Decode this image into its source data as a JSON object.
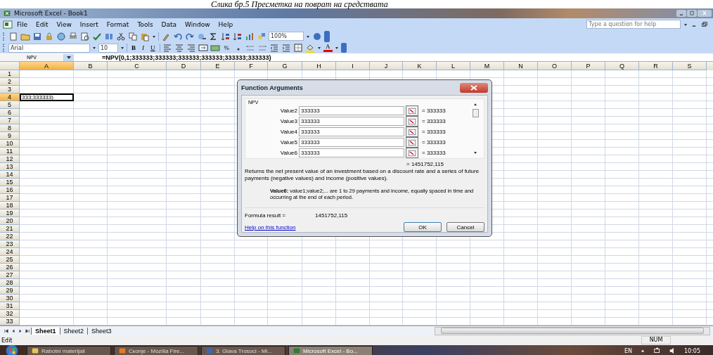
{
  "caption": "Слика бр.5 Пресметка на поврат на средствата",
  "window": {
    "title": "Microsoft Excel - Book1"
  },
  "menu": [
    "File",
    "Edit",
    "View",
    "Insert",
    "Format",
    "Tools",
    "Data",
    "Window",
    "Help"
  ],
  "help_box": {
    "placeholder": "Type a question for help"
  },
  "toolbar": {
    "zoom": "100%"
  },
  "formatting": {
    "font": "Arial",
    "size": "10",
    "buttons": [
      "B",
      "I",
      "U"
    ],
    "percent": "%",
    "font_color": "A"
  },
  "formula_bar": {
    "name_box": "NPV",
    "formula": "=NPV(0,1;333333;333333;333333;333333;333333;333333)"
  },
  "columns": [
    {
      "label": "A",
      "selected": true
    },
    {
      "label": "B",
      "selected": false
    },
    {
      "label": "C",
      "selected": false
    },
    {
      "label": "D",
      "selected": false
    },
    {
      "label": "E",
      "selected": false
    },
    {
      "label": "F",
      "selected": false
    },
    {
      "label": "G",
      "selected": false
    },
    {
      "label": "H",
      "selected": false
    },
    {
      "label": "I",
      "selected": false
    },
    {
      "label": "J",
      "selected": false
    },
    {
      "label": "K",
      "selected": false
    },
    {
      "label": "L",
      "selected": false
    },
    {
      "label": "M",
      "selected": false
    },
    {
      "label": "N",
      "selected": false
    },
    {
      "label": "O",
      "selected": false
    },
    {
      "label": "P",
      "selected": false
    },
    {
      "label": "Q",
      "selected": false
    },
    {
      "label": "R",
      "selected": false
    },
    {
      "label": "S",
      "selected": false
    }
  ],
  "rows": [
    {
      "label": "1",
      "selected": false
    },
    {
      "label": "2",
      "selected": false
    },
    {
      "label": "3",
      "selected": false
    },
    {
      "label": "4",
      "selected": true,
      "column_a": "333;333333)"
    },
    {
      "label": "5",
      "selected": false
    },
    {
      "label": "6",
      "selected": false
    },
    {
      "label": "7",
      "selected": false
    },
    {
      "label": "8",
      "selected": false
    },
    {
      "label": "9",
      "selected": false
    },
    {
      "label": "10",
      "selected": false
    },
    {
      "label": "11",
      "selected": false
    },
    {
      "label": "12",
      "selected": false
    },
    {
      "label": "13",
      "selected": false
    },
    {
      "label": "14",
      "selected": false
    },
    {
      "label": "15",
      "selected": false
    },
    {
      "label": "16",
      "selected": false
    },
    {
      "label": "17",
      "selected": false
    },
    {
      "label": "18",
      "selected": false
    },
    {
      "label": "19",
      "selected": false
    },
    {
      "label": "20",
      "selected": false
    },
    {
      "label": "21",
      "selected": false
    },
    {
      "label": "22",
      "selected": false
    },
    {
      "label": "23",
      "selected": false
    },
    {
      "label": "24",
      "selected": false
    },
    {
      "label": "25",
      "selected": false
    },
    {
      "label": "26",
      "selected": false
    },
    {
      "label": "27",
      "selected": false
    },
    {
      "label": "28",
      "selected": false
    },
    {
      "label": "29",
      "selected": false
    },
    {
      "label": "30",
      "selected": false
    },
    {
      "label": "31",
      "selected": false
    },
    {
      "label": "32",
      "selected": false
    },
    {
      "label": "33",
      "selected": false
    }
  ],
  "dialog": {
    "title": "Function Arguments",
    "function": "NPV",
    "arguments": [
      {
        "label": "Value2",
        "value": "333333",
        "result": "= 333333"
      },
      {
        "label": "Value3",
        "value": "333333",
        "result": "= 333333"
      },
      {
        "label": "Value4",
        "value": "333333",
        "result": "= 333333"
      },
      {
        "label": "Value5",
        "value": "333333",
        "result": "= 333333"
      },
      {
        "label": "Value6",
        "value": "333333",
        "result": "= 333333"
      }
    ],
    "total": "= 1451752,115",
    "description": "Returns the net present value of an investment based on a discount rate and a series of future payments (negative values) and income (positive values).",
    "argument_name": "Value6:",
    "argument_help": "value1;value2;... are 1 to 29 payments and income, equally spaced in time and occurring at the end of each period.",
    "formula_result_label": "Formula result =",
    "formula_result": "1451752,115",
    "help_link": "Help on this function",
    "buttons": [
      "OK",
      "Cancel"
    ]
  },
  "sheet_tabs": [
    {
      "label": "Sheet1",
      "selected": true
    },
    {
      "label": "Sheet2",
      "selected": false
    },
    {
      "label": "Sheet3",
      "selected": false
    }
  ],
  "status_bar": {
    "mode": "Edit",
    "indicators": [
      "NUM"
    ]
  },
  "taskbar": {
    "items": [
      {
        "label": "Rabotni materijali",
        "selected": false
      },
      {
        "label": "Скопје - Mozilla Fire...",
        "selected": false
      },
      {
        "label": "3. Glava Trosoci - Mi...",
        "selected": false
      },
      {
        "label": "Microsoft Excel - Bo...",
        "selected": true
      }
    ],
    "language": "EN",
    "time": "10:05"
  }
}
